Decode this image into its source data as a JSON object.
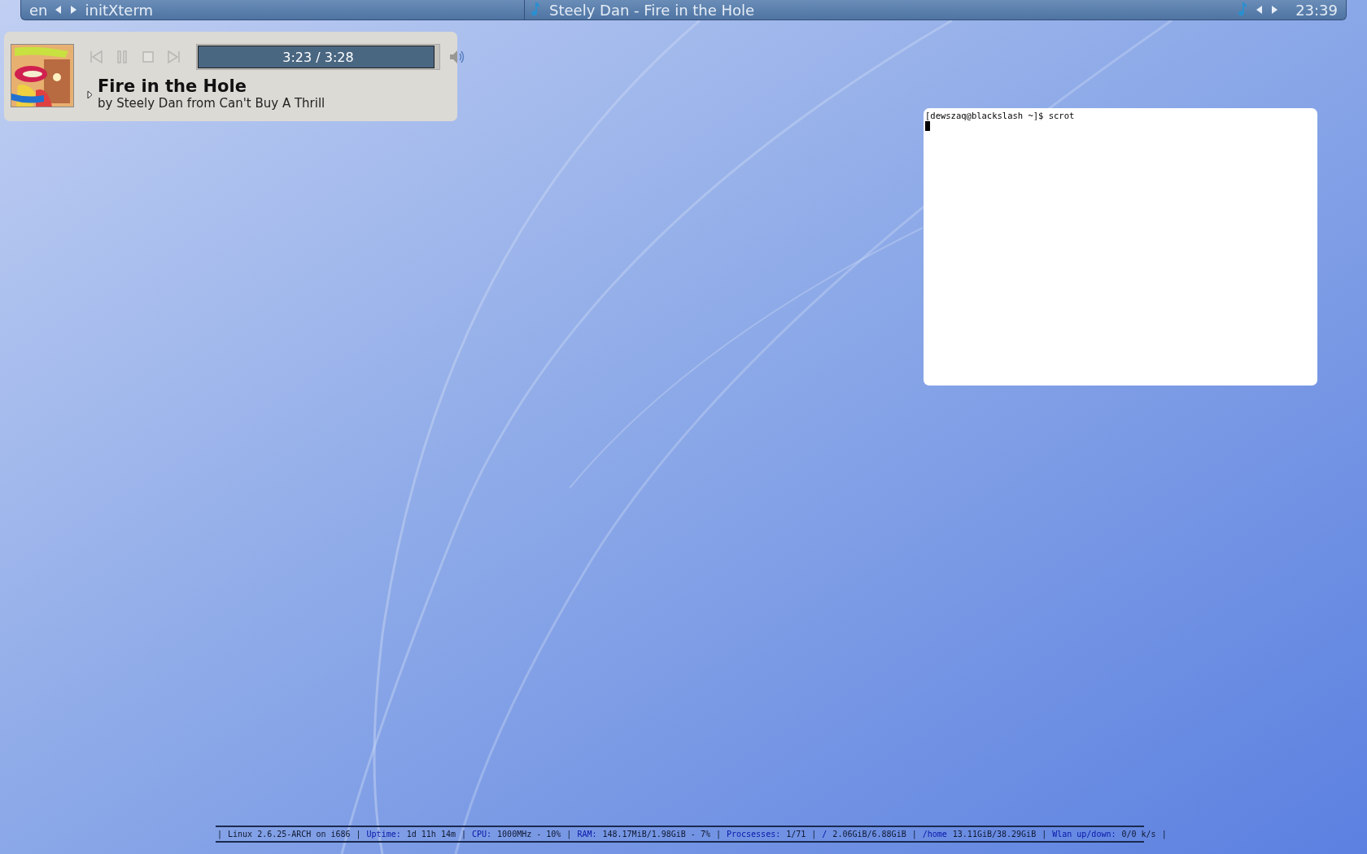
{
  "top_panel": {
    "layout": "en",
    "window_title": "initXterm",
    "now_playing": "Steely Dan - Fire in the Hole",
    "clock": "23:39"
  },
  "player": {
    "elapsed": "3:23 / 3:28",
    "level": 0.975,
    "expanded": false,
    "title": "Fire in the Hole",
    "subtitle": "by Steely Dan from Can't Buy A Thrill"
  },
  "terminal": {
    "lines": [
      "[dewszaq@blackslash ~]$ scrot"
    ]
  },
  "status_bar": {
    "separator": "|",
    "items": [
      {
        "value": "Linux 2.6.25-ARCH on i686"
      },
      {
        "label": "Uptime:",
        "value": "1d 11h 14m"
      },
      {
        "label": "CPU:",
        "value": "1000MHz - 10%"
      },
      {
        "label": "RAM:",
        "value": "148.17MiB/1.98GiB - 7%"
      },
      {
        "label": "Procsesses:",
        "value": "1/71"
      },
      {
        "label": "/",
        "value": "2.06GiB/6.88GiB"
      },
      {
        "label": "/home",
        "value": "13.11GiB/38.29GiB"
      },
      {
        "label": "Wlan up/down:",
        "value": "0/0 k/s"
      }
    ]
  }
}
